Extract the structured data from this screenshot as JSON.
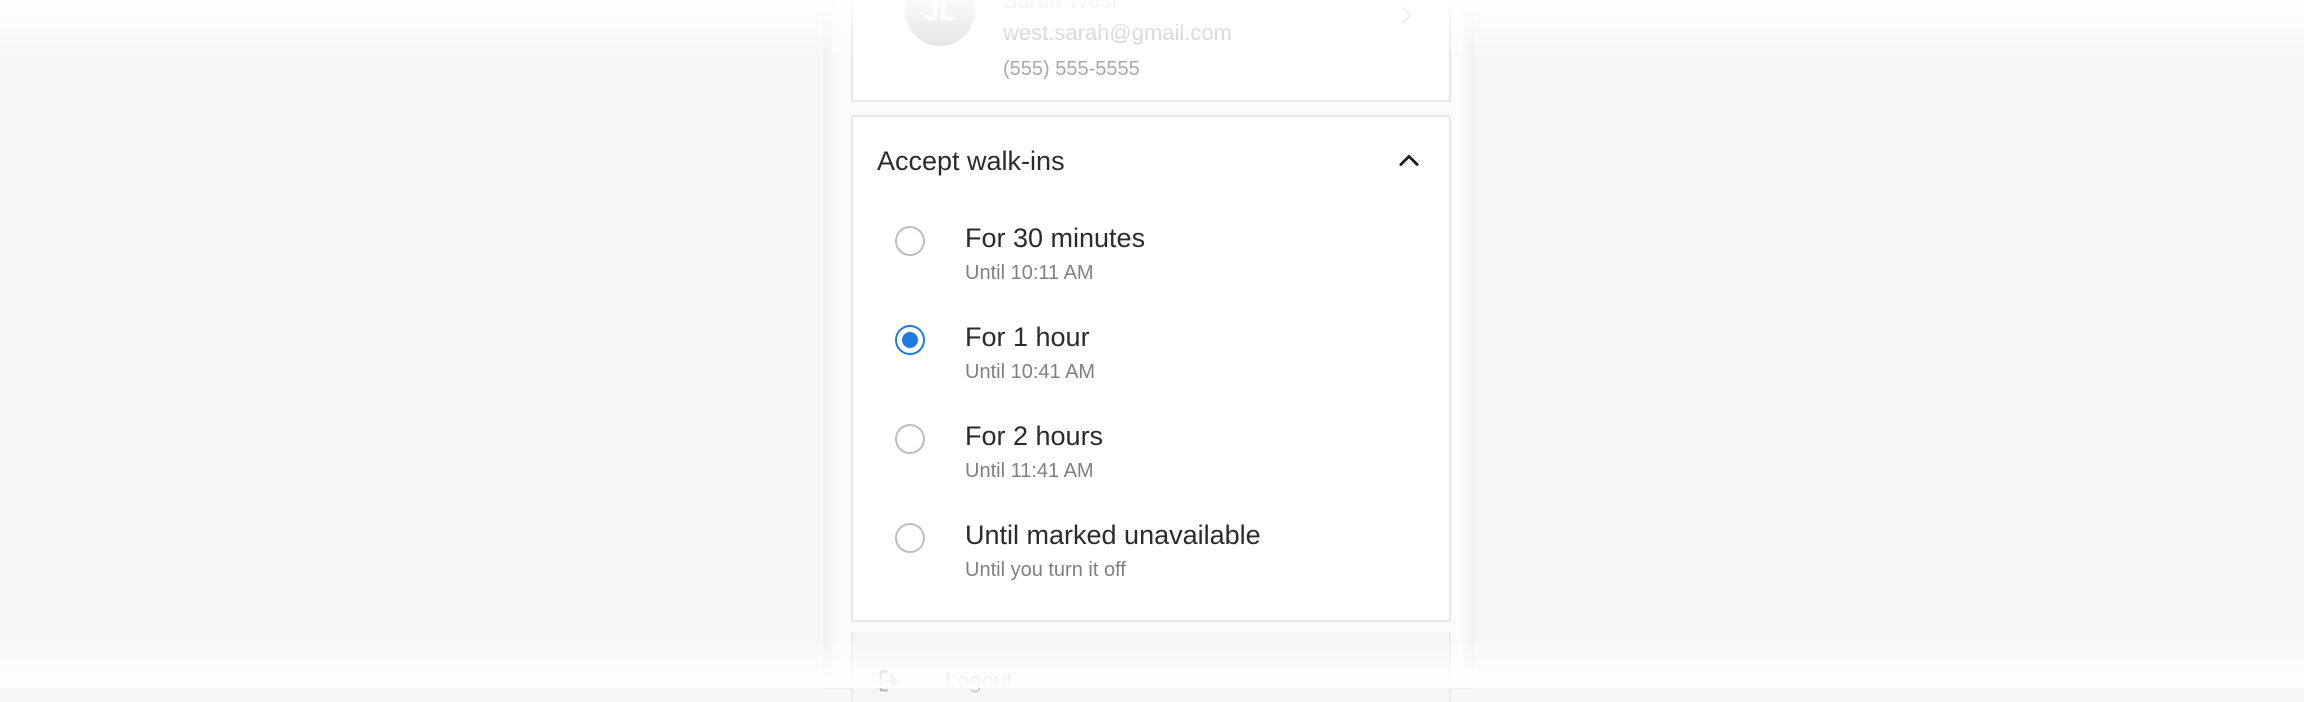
{
  "profile": {
    "avatar_initials": "JL",
    "name": "Sarah West",
    "email": "west.sarah@gmail.com",
    "phone": "(555) 555-5555"
  },
  "walk_ins": {
    "title": "Accept walk-ins",
    "selected_index": 1,
    "options": [
      {
        "label": "For 30 minutes",
        "sub": "Until 10:11 AM"
      },
      {
        "label": "For 1 hour",
        "sub": "Until 10:41 AM"
      },
      {
        "label": "For 2 hours",
        "sub": "Until 11:41 AM"
      },
      {
        "label": "Until marked unavailable",
        "sub": "Until you turn it off"
      }
    ]
  },
  "footer": {
    "logout_label": "Logout"
  },
  "colors": {
    "accent": "#1f7ae0",
    "text_primary": "#2b2b2b",
    "text_secondary": "#808080"
  },
  "icons": [
    "chevron-right-icon",
    "chevron-up-icon",
    "logout-icon"
  ]
}
